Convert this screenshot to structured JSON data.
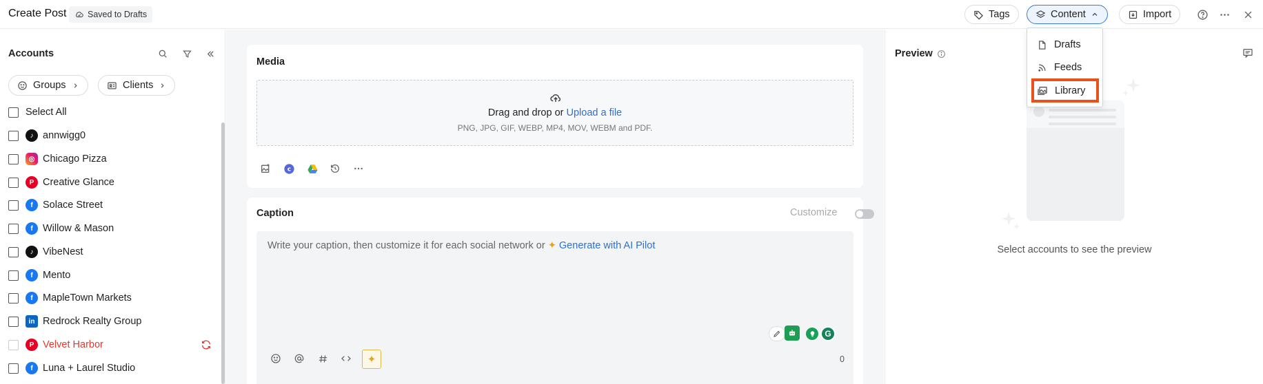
{
  "header": {
    "title": "Create Post",
    "saved_badge": "Saved to Drafts",
    "tags_label": "Tags",
    "content_label": "Content",
    "import_label": "Import"
  },
  "content_menu": {
    "items": [
      {
        "label": "Drafts",
        "icon": "file-icon"
      },
      {
        "label": "Feeds",
        "icon": "rss-icon"
      },
      {
        "label": "Library",
        "icon": "image-library-icon"
      }
    ],
    "highlighted": "Library",
    "highlight_color": "#e8511a"
  },
  "sidebar": {
    "title": "Accounts",
    "groups_label": "Groups",
    "clients_label": "Clients",
    "select_all": "Select All",
    "accounts": [
      {
        "name": "annwigg0",
        "network": "tiktok"
      },
      {
        "name": "Chicago Pizza",
        "network": "instagram"
      },
      {
        "name": "Creative Glance",
        "network": "pinterest"
      },
      {
        "name": "Solace Street",
        "network": "facebook"
      },
      {
        "name": "Willow & Mason",
        "network": "facebook"
      },
      {
        "name": "VibeNest",
        "network": "tiktok"
      },
      {
        "name": "Mento",
        "network": "facebook"
      },
      {
        "name": "MapleTown Markets",
        "network": "facebook"
      },
      {
        "name": "Redrock Realty Group",
        "network": "linkedin"
      },
      {
        "name": "Velvet Harbor",
        "network": "pinterest",
        "status": "error"
      },
      {
        "name": "Luna + Laurel Studio",
        "network": "facebook"
      }
    ],
    "error_color": "#e03a2f"
  },
  "media": {
    "title": "Media",
    "drop_text": "Drag and drop or",
    "upload_link": "Upload a file",
    "formats": "PNG, JPG, GIF, WEBP, MP4, MOV, WEBM and PDF."
  },
  "caption": {
    "title": "Caption",
    "customize_label": "Customize",
    "placeholder": "Write your caption, then customize it for each social network or",
    "ai_link": "Generate with AI Pilot",
    "char_count": "0"
  },
  "preview": {
    "title": "Preview",
    "empty_text": "Select accounts to see the preview"
  },
  "colors": {
    "accent": "#2f6fd1",
    "active_border": "#3a7bd5"
  }
}
